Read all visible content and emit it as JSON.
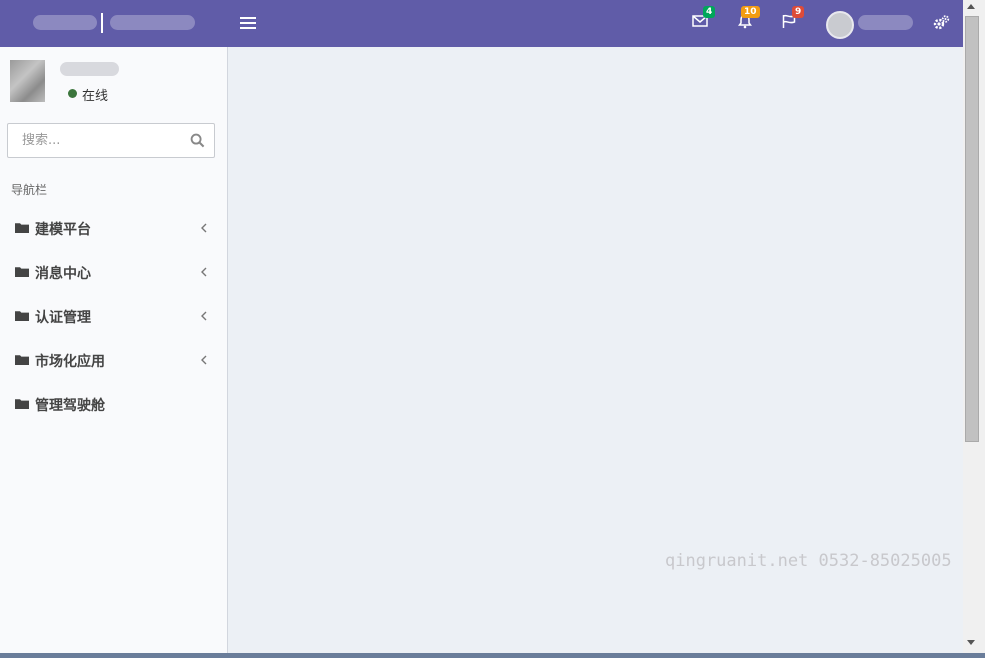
{
  "header": {
    "bg_color": "#605ca8",
    "menu_icon": "hamburger-icon",
    "mail": {
      "icon": "envelope-icon",
      "count": "4",
      "badge_color": "#00a65a"
    },
    "notifications": {
      "icon": "bell-icon",
      "count": "10",
      "badge_color": "#f39c12"
    },
    "tasks": {
      "icon": "flag-icon",
      "count": "9",
      "badge_color": "#dd4b39"
    },
    "settings_icon": "gears-icon"
  },
  "sidebar": {
    "status": "在线",
    "search": {
      "placeholder": "搜索..."
    },
    "nav_header": "导航栏",
    "items": [
      {
        "label": "建模平台",
        "icon": "folder-icon",
        "has_submenu": true
      },
      {
        "label": "消息中心",
        "icon": "folder-icon",
        "has_submenu": true
      },
      {
        "label": "认证管理",
        "icon": "folder-icon",
        "has_submenu": true
      },
      {
        "label": "市场化应用",
        "icon": "folder-icon",
        "has_submenu": true
      },
      {
        "label": "管理驾驶舱",
        "icon": "folder-icon",
        "has_submenu": false
      }
    ]
  },
  "watermark": "qingruanit.net 0532-85025005"
}
